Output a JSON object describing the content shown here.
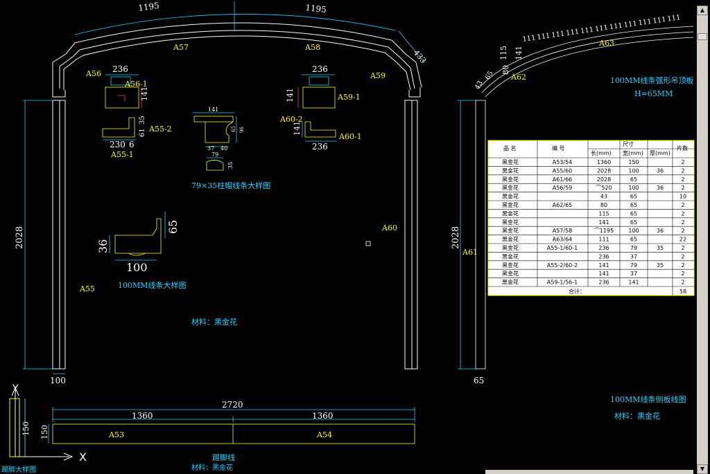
{
  "colors": {
    "background": "#000000",
    "line": "#ffffff",
    "label": "#ffff00",
    "note": "#22d3ff",
    "table_bg": "#ffffff",
    "scrollbar": "#d4d0c8"
  },
  "arch": {
    "top_dim_left": "1195",
    "top_dim_right": "1195",
    "dim_433": "433",
    "labels": {
      "a57": "A57",
      "a58": "A58",
      "a56": "A56",
      "a59": "A59",
      "a55": "A55",
      "a60": "A60"
    },
    "pillar_height": "2028",
    "pillar_width": "100"
  },
  "details": {
    "a56_1": {
      "label": "A56-1",
      "width": "236",
      "height": "141"
    },
    "a59_1": {
      "label": "A59-1",
      "width": "236",
      "height": "141"
    },
    "a55_2": {
      "label": "A55-2",
      "dim_35": "35",
      "dim_61": "61"
    },
    "a55_1": {
      "label": "A55-1",
      "dim_230": "230",
      "dim_6": "6"
    },
    "a60_2": {
      "label": "A60-2",
      "dim": "141"
    },
    "a60_1": {
      "label": "A60-1",
      "dim": "236"
    },
    "pillar_cap": {
      "title": "79×35柱帽线条大样图",
      "dim_141": "141",
      "dim_37": "37",
      "dim_40": "40",
      "dim_79": "79",
      "dim_35": "35",
      "dim_65": "65",
      "dim_96": "96"
    },
    "line100": {
      "title": "100MM线条大样图",
      "width": "100",
      "h65": "65",
      "h36": "36"
    },
    "material_left": "材料：黑金花"
  },
  "base": {
    "total": "2720",
    "left": "1360",
    "right": "1360",
    "height": "150",
    "label_left": "A53",
    "label_right": "A54",
    "title": "踢脚线",
    "material": "材料：黑金花",
    "corner_title": "踢脚大样图"
  },
  "right_panel": {
    "a63": "A63",
    "a62": "A62",
    "a61": "A61",
    "seg_values": "111",
    "dims": [
      "115",
      "141",
      "80",
      "65",
      "43"
    ],
    "pillar_height": "2028",
    "pillar_width": "65",
    "title1": "100MM线条弧形吊顶板",
    "title2": "H=65MM",
    "bottom_title": "100MM线条侧板线图",
    "bottom_material": "材料：黑金花"
  },
  "axis": {
    "y": "Y",
    "x": "X"
  },
  "table": {
    "headers": {
      "name": "品 名",
      "code": "编 号",
      "size": "尺寸",
      "len": "长(mm)",
      "wid": "宽(mm)",
      "thk": "厚(mm)",
      "qty": "片数"
    },
    "rows": [
      {
        "name": "黑金花",
        "code": "A53/54",
        "len": "1360",
        "wid": "150",
        "thk": "",
        "qty": "2"
      },
      {
        "name": "黑金花",
        "code": "A55/60",
        "len": "2028",
        "wid": "100",
        "thk": "36",
        "qty": "2"
      },
      {
        "name": "黑金花",
        "code": "A61/66",
        "len": "2028",
        "wid": "65",
        "thk": "",
        "qty": "2"
      },
      {
        "name": "黑金花",
        "code": "A56/59",
        "len": "⌒520",
        "wid": "100",
        "thk": "36",
        "qty": "2"
      },
      {
        "name": "黑金花",
        "code": "",
        "len": "43",
        "wid": "65",
        "thk": "",
        "qty": "10"
      },
      {
        "name": "黑金花",
        "code": "A62/65",
        "len": "80",
        "wid": "65",
        "thk": "",
        "qty": "2"
      },
      {
        "name": "黑金花",
        "code": "",
        "len": "115",
        "wid": "65",
        "thk": "",
        "qty": "2"
      },
      {
        "name": "黑金花",
        "code": "",
        "len": "141",
        "wid": "65",
        "thk": "",
        "qty": "2"
      },
      {
        "name": "黑金花",
        "code": "A57/58",
        "len": "⌒1195",
        "wid": "100",
        "thk": "36",
        "qty": "2"
      },
      {
        "name": "黑金花",
        "code": "A63/64",
        "len": "111",
        "wid": "65",
        "thk": "",
        "qty": "22"
      },
      {
        "name": "黑金花",
        "code": "A55-1/60-1",
        "len": "236",
        "wid": "79",
        "thk": "35",
        "qty": "2"
      },
      {
        "name": "黑金花",
        "code": "",
        "len": "236",
        "wid": "37",
        "thk": "",
        "qty": "2"
      },
      {
        "name": "黑金花",
        "code": "A55-2/60-2",
        "len": "141",
        "wid": "79",
        "thk": "35",
        "qty": "2"
      },
      {
        "name": "黑金花",
        "code": "",
        "len": "141",
        "wid": "37",
        "thk": "",
        "qty": "2"
      },
      {
        "name": "黑金花",
        "code": "A59-1/56-1",
        "len": "236",
        "wid": "141",
        "thk": "",
        "qty": "2"
      }
    ],
    "total_label": "合计：",
    "total_value": "58"
  }
}
